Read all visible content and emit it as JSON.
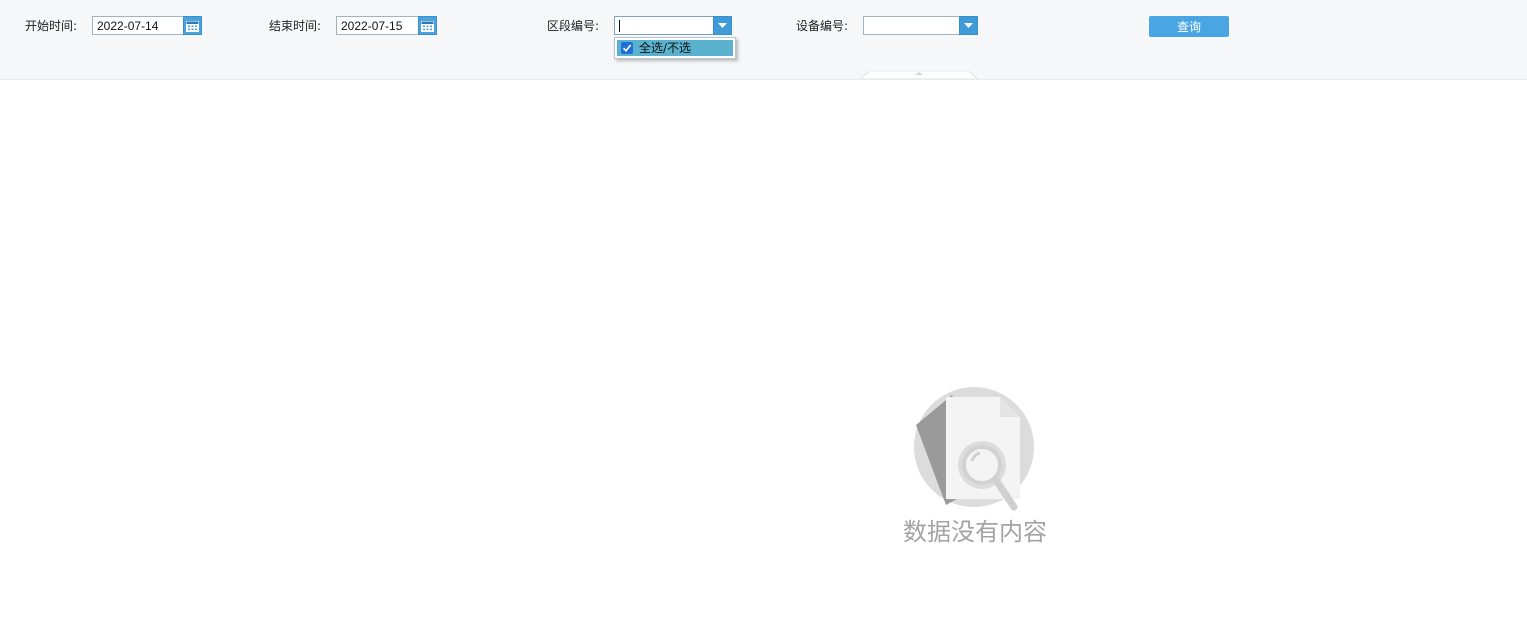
{
  "filters": {
    "start": {
      "label": "开始时间:",
      "value": "2022-07-14"
    },
    "end": {
      "label": "结束时间:",
      "value": "2022-07-15"
    },
    "section": {
      "label": "区段编号:",
      "value": ""
    },
    "device": {
      "label": "设备编号:",
      "value": ""
    }
  },
  "section_dropdown": {
    "items": [
      {
        "label": "全选/不选",
        "checked": true
      }
    ]
  },
  "query_button": {
    "label": "查询"
  },
  "empty_state": {
    "text": "数据没有内容",
    "icon": "empty-document-search-icon"
  },
  "colors": {
    "accent": "#49a6e3",
    "toolbar_bg": "#f5f7f9",
    "highlight": "#5bb2cf",
    "empty_text": "#a3a3a3"
  }
}
